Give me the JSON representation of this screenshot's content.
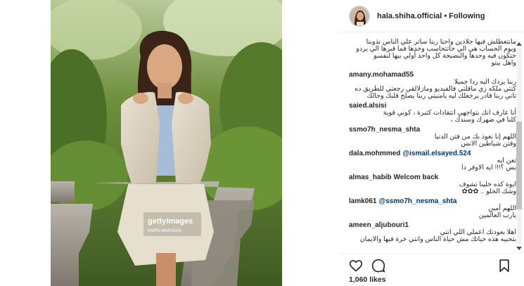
{
  "header": {
    "username": "hala.shiha.official",
    "separator": "•",
    "follow_status": "Following"
  },
  "photo": {
    "watermark_brand": "gettyimages",
    "watermark_credit": "AMRO MARAGHI"
  },
  "comments": {
    "top_text": [
      "مانتعطلش فيها جلادين واحنا ربنا ساتر علي الناس نذوبنا",
      "ويوم الحساب هي الي حاتتحاسب وحدها فما قبرها الي يردو",
      "حتكون فيه وحدها والنصيحة كل واحد أولي بيها لنفسو",
      "واهل بيتو"
    ],
    "items": [
      {
        "user": "amany.mohamad55",
        "inline": "",
        "lines": [
          "ربنا يردك اليه ردا جميلا",
          "كنتي ملكه زي ماقلتي فالفيديو ومازلالقي رجعتي للطريق ده",
          "تاني ربنا قادر يرجعلك ليه يامنيتي ربنا يصلح قلبك وحالك"
        ]
      },
      {
        "user": "saied.alsisi",
        "inline": "",
        "lines": [
          "أنا عارف انك بتواجهي انتقادات كتيرة ، كوني قوية",
          "كلنا في ضهرك وسندك ،"
        ]
      },
      {
        "user": "ssmo7h_nesma_shta",
        "inline": "",
        "lines": [
          "اللهم إنا نعوذ بك من فتن الدنيا",
          "وفتن شياطين الانس"
        ]
      },
      {
        "user": "dala.mohmmed",
        "mention": "@ismail.elsayed.524",
        "inline": "",
        "lines": [
          "تعن ايه",
          "بس ؟!!! ايه الاوفر دا"
        ]
      },
      {
        "user": "almas_habib",
        "inline": "Welcom back",
        "lines": [
          "ايوة كده خلينا نشوف",
          "وشك الحلو .. ✿✿✿"
        ]
      },
      {
        "user": "lamk061",
        "mention": "@ssmo7h_nesma_shta",
        "inline": "",
        "lines": [
          "اللهم آمين",
          "يارب العالمين"
        ]
      },
      {
        "user": "ameen_aljubouri1",
        "inline": "",
        "lines": [
          "اهلا بعودتك اعملي اللي انتي",
          "بتحبيه هذه حياتك مش حياة الناس وانتي حرة فيها والايمان"
        ]
      }
    ]
  },
  "footer": {
    "likes": "1,060 likes"
  },
  "icons": [
    "heart-icon",
    "comment-icon",
    "bookmark-icon"
  ],
  "colors": {
    "username": "#262626",
    "mention": "#003569",
    "border": "#efefef"
  }
}
